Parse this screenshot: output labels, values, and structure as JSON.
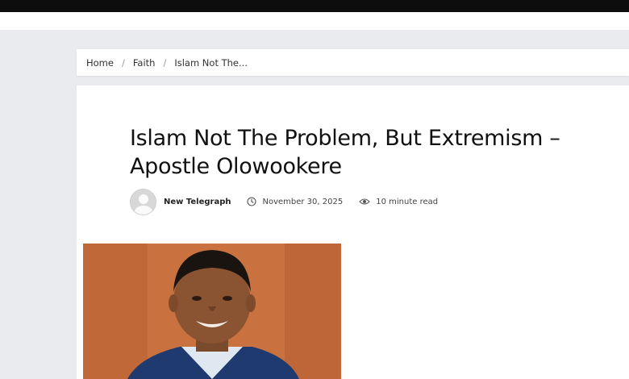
{
  "breadcrumb": {
    "items": [
      {
        "label": "Home"
      },
      {
        "label": "Faith"
      },
      {
        "label": "Islam Not The..."
      }
    ],
    "separator": "/"
  },
  "article": {
    "title": "Islam Not The Problem, But Extremism – Apostle Olowookere",
    "author": "New Telegraph",
    "date": "November 30, 2025",
    "read_time": "10 minute read",
    "icons": {
      "avatar": "default-user-avatar",
      "date": "clock-icon",
      "read_time": "eye-icon"
    }
  },
  "colors": {
    "top_bar": "#0d0d0d",
    "page_bg": "#e9ebee",
    "card_bg": "#ffffff",
    "title_text": "#111111"
  }
}
